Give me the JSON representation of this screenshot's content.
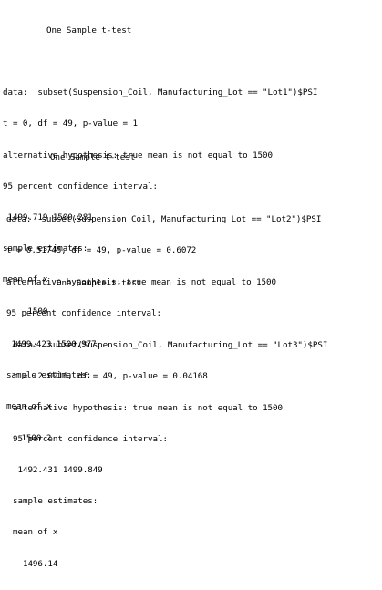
{
  "results": [
    {
      "title": "One Sample t-test",
      "data_line": "data:  subset(Suspension_Coil, Manufacturing_Lot == \"Lot1\")$PSI",
      "stats_line": "t = 0, df = 49, p-value = 1",
      "alt_line": "alternative hypothesis: true mean is not equal to 1500",
      "ci_label": "95 percent confidence interval:",
      "ci_values": " 1499.719 1500.281",
      "estimates_label": "sample estimates:",
      "mean_label": "mean of x",
      "mean_value": "     1500"
    },
    {
      "title": "One Sample t-test",
      "data_line": "data:  subset(Suspension_Coil, Manufacturing_Lot == \"Lot2\")$PSI",
      "stats_line": "t = 0.51745, df = 49, p-value = 0.6072",
      "alt_line": "alternative hypothesis: true mean is not equal to 1500",
      "ci_label": "95 percent confidence interval:",
      "ci_values": " 1499.423 1500.977",
      "estimates_label": "sample estimates:",
      "mean_label": "mean of x",
      "mean_value": "   1500.2"
    },
    {
      "title": "One Sample t-test",
      "data_line": "data:  subset(Suspension_Coil, Manufacturing_Lot == \"Lot3\")$PSI",
      "stats_line": "t = -2.0916, df = 49, p-value = 0.04168",
      "alt_line": "alternative hypothesis: true mean is not equal to 1500",
      "ci_label": "95 percent confidence interval:",
      "ci_values": " 1492.431 1499.849",
      "estimates_label": "sample estimates:",
      "mean_label": "mean of x",
      "mean_value": "  1496.14"
    }
  ]
}
